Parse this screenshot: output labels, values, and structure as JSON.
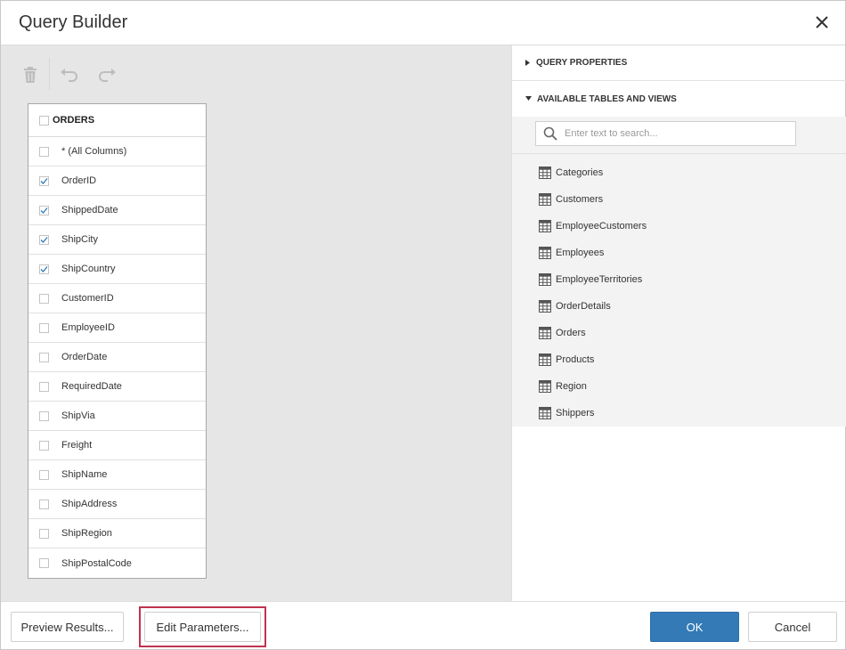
{
  "dialog": {
    "title": "Query Builder"
  },
  "toolbar": {
    "items": [
      "trash-icon",
      "undo-icon",
      "redo-icon"
    ]
  },
  "table": {
    "name": "ORDERS",
    "fields": [
      {
        "label": "* (All Columns)",
        "checked": false
      },
      {
        "label": "OrderID",
        "checked": true
      },
      {
        "label": "ShippedDate",
        "checked": true
      },
      {
        "label": "ShipCity",
        "checked": true
      },
      {
        "label": "ShipCountry",
        "checked": true
      },
      {
        "label": "CustomerID",
        "checked": false
      },
      {
        "label": "EmployeeID",
        "checked": false
      },
      {
        "label": "OrderDate",
        "checked": false
      },
      {
        "label": "RequiredDate",
        "checked": false
      },
      {
        "label": "ShipVia",
        "checked": false
      },
      {
        "label": "Freight",
        "checked": false
      },
      {
        "label": "ShipName",
        "checked": false
      },
      {
        "label": "ShipAddress",
        "checked": false
      },
      {
        "label": "ShipRegion",
        "checked": false
      },
      {
        "label": "ShipPostalCode",
        "checked": false
      }
    ]
  },
  "panel": {
    "query_properties": "QUERY PROPERTIES",
    "available_tables": "AVAILABLE TABLES AND VIEWS",
    "search_placeholder": "Enter text to search...",
    "tables": [
      "Categories",
      "Customers",
      "EmployeeCustomers",
      "Employees",
      "EmployeeTerritories",
      "OrderDetails",
      "Orders",
      "Products",
      "Region",
      "Shippers"
    ]
  },
  "footer": {
    "preview_label": "Preview Results...",
    "edit_params_label": "Edit Parameters...",
    "ok_label": "OK",
    "cancel_label": "Cancel"
  },
  "colors": {
    "primary": "#337ab7",
    "highlight": "#c0334d",
    "canvas": "#e6e6e6"
  }
}
